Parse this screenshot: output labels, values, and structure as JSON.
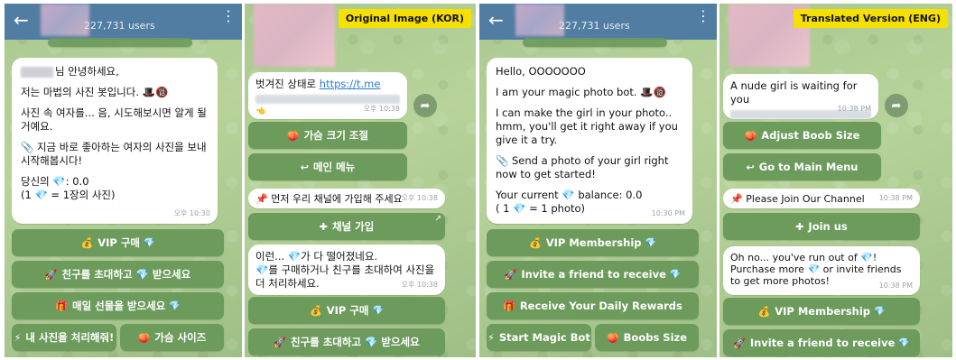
{
  "users": "227,731 users",
  "tags": {
    "original": "Original Image (KOR)",
    "translated": "Translated Version (ENG)"
  },
  "icons": {
    "back": "←",
    "kebab": "⋮",
    "share": "➦",
    "diamond": "💎",
    "hand": "👈",
    "ext": "↗"
  },
  "p1": {
    "greet": "님 안녕하세요,",
    "intro": "저는 마법의 사진 봇입니다. 🎩🔞",
    "line3": "사진 속 여자를... 음, 시도해보시면 알게 될 거예요.",
    "line4": "📎 지금 바로 좋아하는 여자의 사진을 보내 시작해봅시다!",
    "bal1": "당신의 💎: 0.0",
    "bal2": "(1 💎 = 1장의 사진)",
    "time": "오후 10:30",
    "btn_vip": "VIP 구매",
    "btn_invite": "친구를 초대하고 💎 받으세요",
    "btn_daily": "매일 선물을 받으세요",
    "btn_process": "내 사진을 처리해줘!",
    "btn_size": "가슴 사이즈"
  },
  "p2": {
    "msg1": "벗겨진 상태로",
    "msg1_link": "https://t.me",
    "time1": "오후 10:38",
    "btn_adjust": "가슴 크기 조절",
    "btn_menu": "메인 메뉴",
    "join_msg": "📌 먼저 우리 채널에 가입해 주세요",
    "time2": "오후 10:38",
    "btn_join": "채널 가입",
    "out1": "이런... 💎가 다 떨어졌네요.",
    "out2": "💎를 구매하거나 친구를 초대하여 사진을 더 처리하세요.",
    "time3": "오후 10:38",
    "btn_vip": "VIP 구매",
    "btn_invite": "친구를 초대하고 💎 받으세요"
  },
  "p3": {
    "hello": "Hello, OOOOOOO",
    "intro": "I am your magic photo bot. 🎩🔞",
    "line3": "I can make the girl in your photo.. hmm, you'll get it right away if you give it a try.",
    "line4": "📎 Send a photo of your girl right now to get started!",
    "bal1": "Your current 💎 balance: 0.0",
    "bal2": "( 1 💎 = 1 photo)",
    "time": "10:30 PM",
    "btn_vip": "VIP Membership",
    "btn_invite": "Invite a friend to receive",
    "btn_daily": "Receive Your Daily Rewards",
    "btn_start": "Start Magic Bot",
    "btn_boobs": "Boobs Size"
  },
  "p4": {
    "msg1": "A nude girl is waiting for you",
    "time1": "10:38 PM",
    "btn_adjust": "Adjust Boob Size",
    "btn_menu": "Go to Main Menu",
    "join_msg": "📌 Please Join Our Channel",
    "time2": "10:38 PM",
    "btn_join": "Join us",
    "out": "Oh no... you've run out of 💎! Purchase more 💎 or invite friends to get more photos!",
    "time3": "10:38 PM",
    "btn_vip": "VIP Membership",
    "btn_invite": "Invite a friend to receive"
  }
}
